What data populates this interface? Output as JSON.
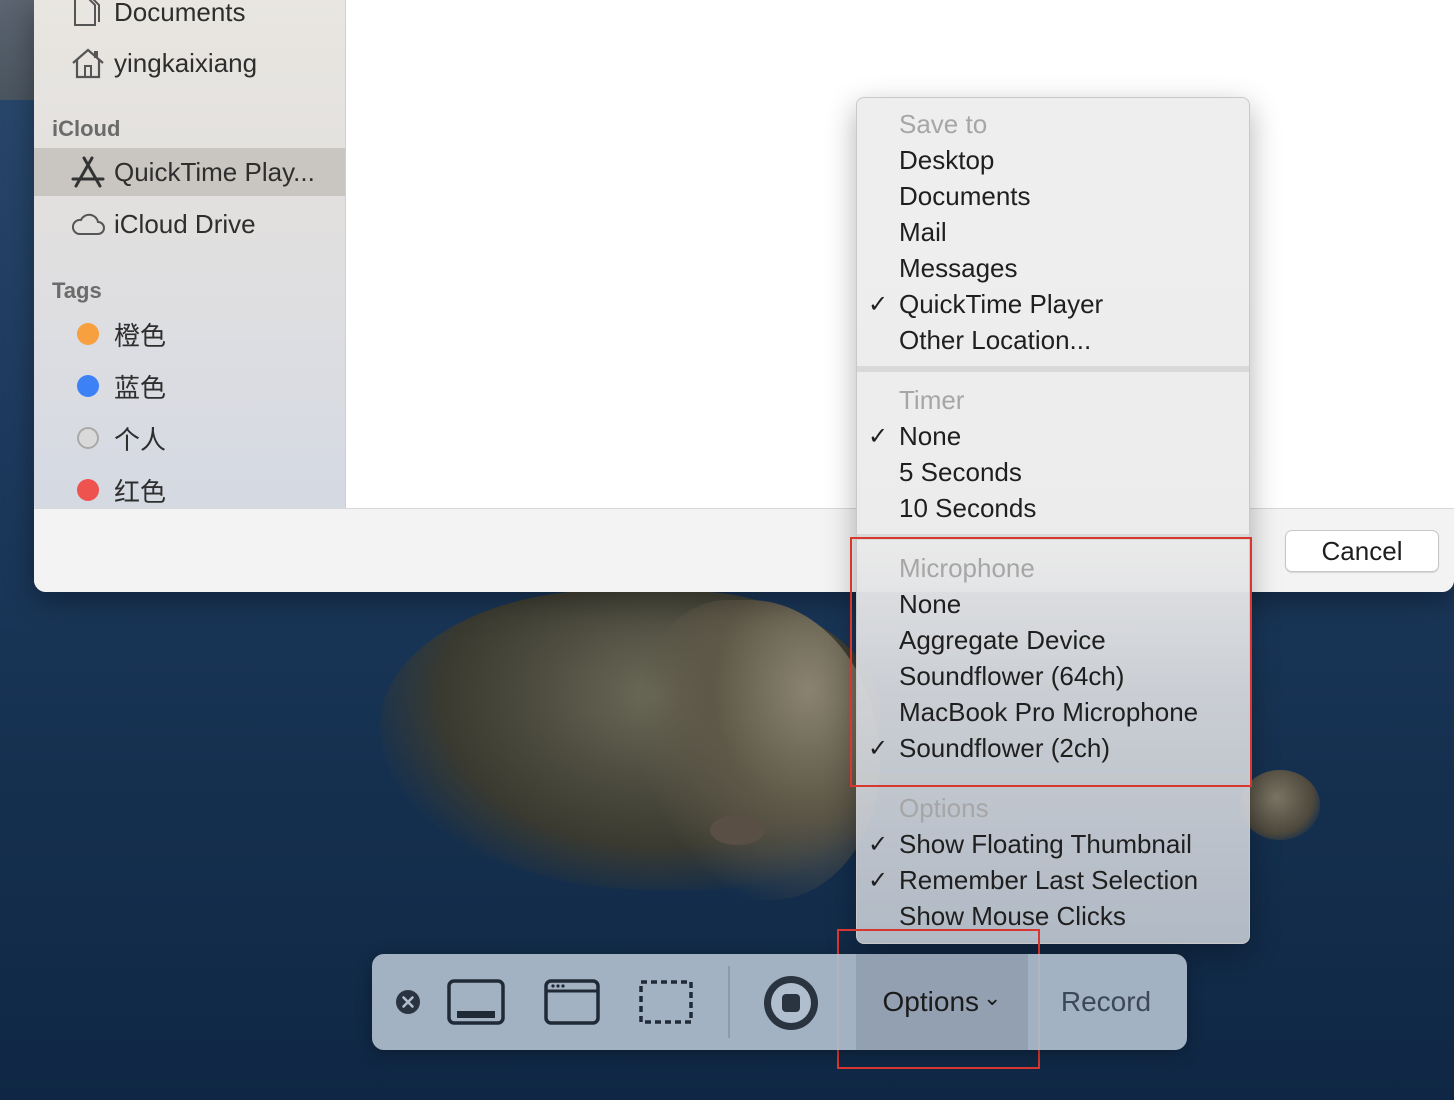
{
  "sidebar": {
    "items_top": [
      {
        "label": "Documents",
        "icon": "documents-icon"
      },
      {
        "label": "yingkaixiang",
        "icon": "home-icon"
      }
    ],
    "icloud_header": "iCloud",
    "icloud_items": [
      {
        "label": "QuickTime Play...",
        "icon": "app-store-icon",
        "selected": true
      },
      {
        "label": "iCloud Drive",
        "icon": "cloud-icon"
      }
    ],
    "tags_header": "Tags",
    "tags": [
      {
        "label": "橙色",
        "color": "#f6a03f"
      },
      {
        "label": "蓝色",
        "color": "#3c82f6"
      },
      {
        "label": "个人",
        "color": "#c8c8c8"
      },
      {
        "label": "红色",
        "color": "#ef5350"
      }
    ]
  },
  "dialog": {
    "cancel_label": "Cancel"
  },
  "menu": {
    "save_to": {
      "header": "Save to",
      "items": [
        {
          "label": "Desktop",
          "checked": false
        },
        {
          "label": "Documents",
          "checked": false
        },
        {
          "label": "Mail",
          "checked": false
        },
        {
          "label": "Messages",
          "checked": false
        },
        {
          "label": "QuickTime Player",
          "checked": true
        },
        {
          "label": "Other Location...",
          "checked": false
        }
      ]
    },
    "timer": {
      "header": "Timer",
      "items": [
        {
          "label": "None",
          "checked": true
        },
        {
          "label": "5 Seconds",
          "checked": false
        },
        {
          "label": "10 Seconds",
          "checked": false
        }
      ]
    },
    "microphone": {
      "header": "Microphone",
      "items": [
        {
          "label": "None",
          "checked": false
        },
        {
          "label": "Aggregate Device",
          "checked": false
        },
        {
          "label": "Soundflower (64ch)",
          "checked": false
        },
        {
          "label": "MacBook Pro Microphone",
          "checked": false
        },
        {
          "label": "Soundflower (2ch)",
          "checked": true
        }
      ]
    },
    "options": {
      "header": "Options",
      "items": [
        {
          "label": "Show Floating Thumbnail",
          "checked": true
        },
        {
          "label": "Remember Last Selection",
          "checked": true
        },
        {
          "label": "Show Mouse Clicks",
          "checked": false
        }
      ]
    },
    "check_glyph": "✓"
  },
  "toolbar": {
    "options_label": "Options",
    "options_chevron": "⌄",
    "record_label": "Record",
    "icons": [
      "close-icon",
      "capture-entire-screen-icon",
      "capture-window-icon",
      "capture-selection-icon",
      "stop-record-icon"
    ]
  },
  "annotation_color": "#d8372f"
}
